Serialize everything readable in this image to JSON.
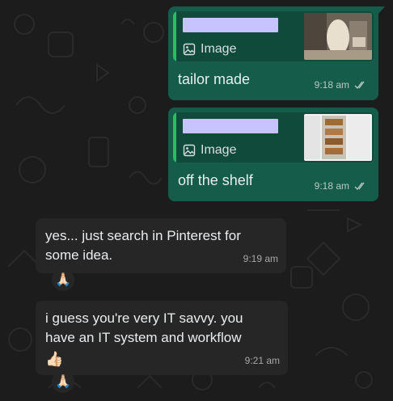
{
  "messages_out": [
    {
      "quote_type": "Image",
      "text": "tailor made",
      "time": "9:18 am"
    },
    {
      "quote_type": "Image",
      "text": "off the shelf",
      "time": "9:18 am"
    }
  ],
  "messages_in": [
    {
      "text": "yes... just search in Pinterest for some idea.",
      "time": "9:19 am",
      "reaction": "🙏🏻"
    },
    {
      "text": "i guess you're very IT savvy. you have an IT system and workflow",
      "emoji_line": "👍🏻",
      "time": "9:21 am",
      "reaction": "🙏🏻"
    }
  ],
  "colors": {
    "outgoing_bubble": "#155d4a",
    "quote_bar": "#21c063",
    "incoming_bubble": "#262626",
    "background": "#1c1c1c"
  }
}
